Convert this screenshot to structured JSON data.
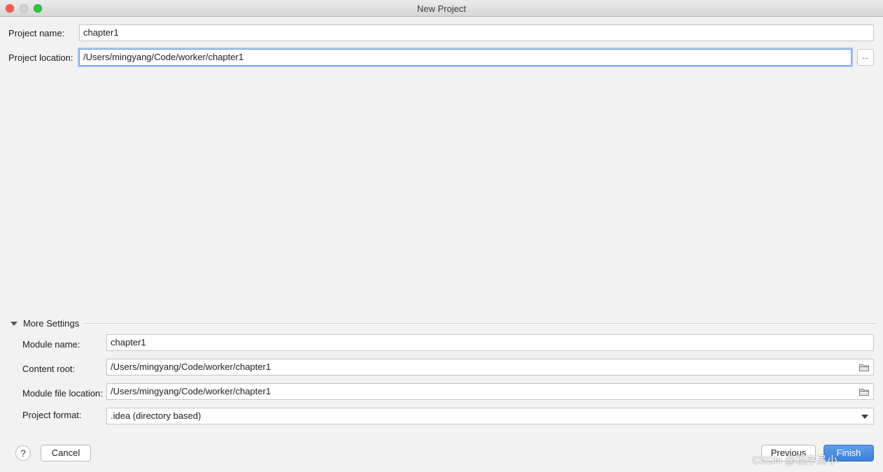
{
  "window": {
    "title": "New Project"
  },
  "project": {
    "name_label": "Project name:",
    "name_value": "chapter1",
    "location_label": "Project location:",
    "location_value": "/Users/mingyang/Code/worker/chapter1",
    "browse_label": "..."
  },
  "more_settings": {
    "title": "More Settings",
    "module_name_label": "Module name:",
    "module_name_value": "chapter1",
    "content_root_label": "Content root:",
    "content_root_value": "/Users/mingyang/Code/worker/chapter1",
    "module_file_label": "Module file location:",
    "module_file_value": "/Users/mingyang/Code/worker/chapter1",
    "format_label": "Project format:",
    "format_value": ".idea (directory based)"
  },
  "footer": {
    "help_label": "?",
    "cancel_label": "Cancel",
    "previous_label": "Previous",
    "finish_label": "Finish"
  },
  "watermark": "CSDN @程序员小"
}
